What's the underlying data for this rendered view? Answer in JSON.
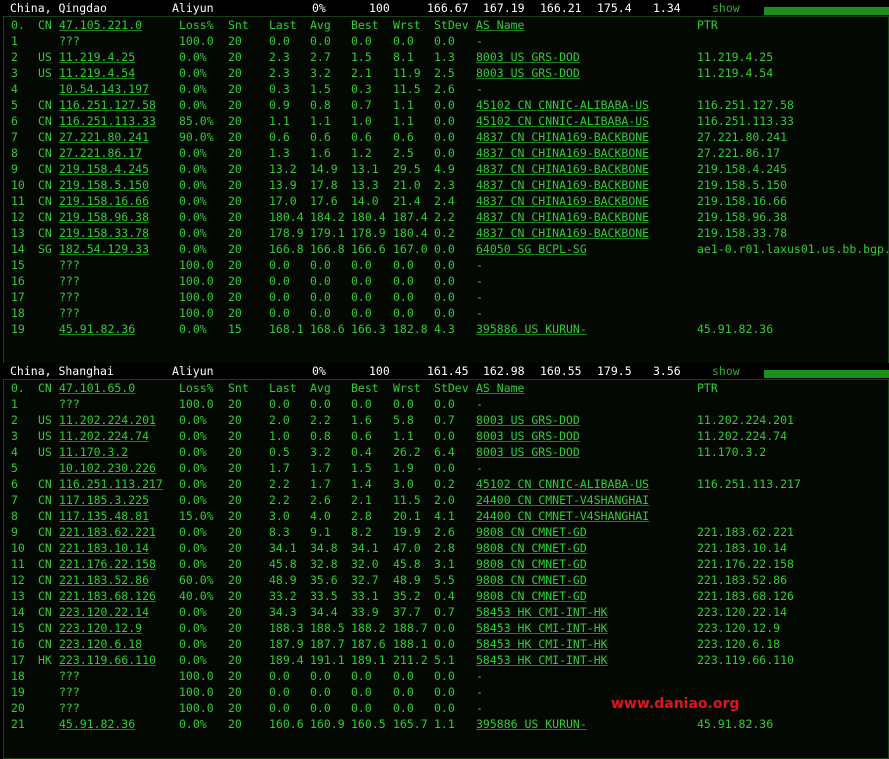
{
  "colors": {
    "text": "#33cc33",
    "header_text": "#ffffff",
    "watermark": "#e0141e",
    "bar": "#1a8f1a"
  },
  "columns": [
    "Loss%",
    "Snt",
    "Last",
    "Avg",
    "Best",
    "Wrst",
    "StDev",
    "AS Name",
    "PTR"
  ],
  "sections": [
    {
      "header": {
        "location": "China, Qingdao",
        "provider": "Aliyun",
        "loss": "0%",
        "sent": "100",
        "last": "166.67",
        "avg": "167.19",
        "best": "166.21",
        "worst": "175.4",
        "stdev": "1.34",
        "show": "show"
      },
      "rows": [
        [
          "0.",
          "CN",
          "47.105.221.0",
          "Loss%",
          "Snt",
          "Last",
          "Avg",
          "Best",
          "Wrst",
          "StDev",
          "AS Name",
          "PTR"
        ],
        [
          "1",
          "",
          "???",
          "100.0",
          "20",
          "0.0",
          "0.0",
          "0.0",
          "0.0",
          "0.0",
          "-",
          ""
        ],
        [
          "2",
          "US",
          "11.219.4.25",
          "0.0%",
          "20",
          "2.3",
          "2.7",
          "1.5",
          "8.1",
          "1.3",
          "8003  US GRS-DOD",
          "11.219.4.25"
        ],
        [
          "3",
          "US",
          "11.219.4.54",
          "0.0%",
          "20",
          "2.3",
          "3.2",
          "2.1",
          "11.9",
          "2.5",
          "8003  US GRS-DOD",
          "11.219.4.54"
        ],
        [
          "4",
          "",
          "10.54.143.197",
          "0.0%",
          "20",
          "0.3",
          "1.5",
          "0.3",
          "11.5",
          "2.6",
          "-",
          ""
        ],
        [
          "5",
          "CN",
          "116.251.127.58",
          "0.0%",
          "20",
          "0.9",
          "0.8",
          "0.7",
          "1.1",
          "0.0",
          "45102 CN CNNIC-ALIBABA-US",
          "116.251.127.58"
        ],
        [
          "6",
          "CN",
          "116.251.113.33",
          "85.0%",
          "20",
          "1.1",
          "1.1",
          "1.0",
          "1.1",
          "0.0",
          "45102 CN CNNIC-ALIBABA-US",
          "116.251.113.33"
        ],
        [
          "7",
          "CN",
          "27.221.80.241",
          "90.0%",
          "20",
          "0.6",
          "0.6",
          "0.6",
          "0.6",
          "0.0",
          "4837  CN CHINA169-BACKBONE",
          "27.221.80.241"
        ],
        [
          "8",
          "CN",
          "27.221.86.17",
          "0.0%",
          "20",
          "1.3",
          "1.6",
          "1.2",
          "2.5",
          "0.0",
          "4837  CN CHINA169-BACKBONE",
          "27.221.86.17"
        ],
        [
          "9",
          "CN",
          "219.158.4.245",
          "0.0%",
          "20",
          "13.2",
          "14.9",
          "13.1",
          "29.5",
          "4.9",
          "4837  CN CHINA169-BACKBONE",
          "219.158.4.245"
        ],
        [
          "10",
          "CN",
          "219.158.5.150",
          "0.0%",
          "20",
          "13.9",
          "17.8",
          "13.3",
          "21.0",
          "2.3",
          "4837  CN CHINA169-BACKBONE",
          "219.158.5.150"
        ],
        [
          "11",
          "CN",
          "219.158.16.66",
          "0.0%",
          "20",
          "17.0",
          "17.6",
          "14.0",
          "21.4",
          "2.4",
          "4837  CN CHINA169-BACKBONE",
          "219.158.16.66"
        ],
        [
          "12",
          "CN",
          "219.158.96.38",
          "0.0%",
          "20",
          "180.4",
          "184.2",
          "180.4",
          "187.4",
          "2.2",
          "4837  CN CHINA169-BACKBONE",
          "219.158.96.38"
        ],
        [
          "13",
          "CN",
          "219.158.33.78",
          "0.0%",
          "20",
          "178.9",
          "179.1",
          "178.9",
          "180.4",
          "0.2",
          "4837  CN CHINA169-BACKBONE",
          "219.158.33.78"
        ],
        [
          "14",
          "SG",
          "182.54.129.33",
          "0.0%",
          "20",
          "166.8",
          "166.8",
          "166.6",
          "167.0",
          "0.0",
          "64050 SG BCPL-SG",
          "ae1-0.r01.laxus01.us.bb.bgp."
        ],
        [
          "15",
          "",
          "???",
          "100.0",
          "20",
          "0.0",
          "0.0",
          "0.0",
          "0.0",
          "0.0",
          "-",
          ""
        ],
        [
          "16",
          "",
          "???",
          "100.0",
          "20",
          "0.0",
          "0.0",
          "0.0",
          "0.0",
          "0.0",
          "-",
          ""
        ],
        [
          "17",
          "",
          "???",
          "100.0",
          "20",
          "0.0",
          "0.0",
          "0.0",
          "0.0",
          "0.0",
          "-",
          ""
        ],
        [
          "18",
          "",
          "???",
          "100.0",
          "20",
          "0.0",
          "0.0",
          "0.0",
          "0.0",
          "0.0",
          "-",
          ""
        ],
        [
          "19",
          "",
          "45.91.82.36",
          "0.0%",
          "15",
          "168.1",
          "168.6",
          "166.3",
          "182.8",
          "4.3",
          "395886 US KURUN-",
          "45.91.82.36"
        ]
      ]
    },
    {
      "header": {
        "location": "China, Shanghai",
        "provider": "Aliyun",
        "loss": "0%",
        "sent": "100",
        "last": "161.45",
        "avg": "162.98",
        "best": "160.55",
        "worst": "179.5",
        "stdev": "3.56",
        "show": "show"
      },
      "rows": [
        [
          "0.",
          "CN",
          "47.101.65.0",
          "Loss%",
          "Snt",
          "Last",
          "Avg",
          "Best",
          "Wrst",
          "StDev",
          "AS Name",
          "PTR"
        ],
        [
          "1",
          "",
          "???",
          "100.0",
          "20",
          "0.0",
          "0.0",
          "0.0",
          "0.0",
          "0.0",
          "-",
          ""
        ],
        [
          "2",
          "US",
          "11.202.224.201",
          "0.0%",
          "20",
          "2.0",
          "2.2",
          "1.6",
          "5.8",
          "0.7",
          "8003  US GRS-DOD",
          "11.202.224.201"
        ],
        [
          "3",
          "US",
          "11.202.224.74",
          "0.0%",
          "20",
          "1.0",
          "0.8",
          "0.6",
          "1.1",
          "0.0",
          "8003  US GRS-DOD",
          "11.202.224.74"
        ],
        [
          "4",
          "US",
          "11.170.3.2",
          "0.0%",
          "20",
          "0.5",
          "3.2",
          "0.4",
          "26.2",
          "6.4",
          "8003  US GRS-DOD",
          "11.170.3.2"
        ],
        [
          "5",
          "",
          "10.102.230.226",
          "0.0%",
          "20",
          "1.7",
          "1.7",
          "1.5",
          "1.9",
          "0.0",
          "-",
          ""
        ],
        [
          "6",
          "CN",
          "116.251.113.217",
          "0.0%",
          "20",
          "2.2",
          "1.7",
          "1.4",
          "3.0",
          "0.2",
          "45102 CN CNNIC-ALIBABA-US",
          "116.251.113.217"
        ],
        [
          "7",
          "CN",
          "117.185.3.225",
          "0.0%",
          "20",
          "2.2",
          "2.6",
          "2.1",
          "11.5",
          "2.0",
          "24400 CN CMNET-V4SHANGHAI",
          ""
        ],
        [
          "8",
          "CN",
          "117.135.48.81",
          "15.0%",
          "20",
          "3.0",
          "4.0",
          "2.8",
          "20.1",
          "4.1",
          "24400 CN CMNET-V4SHANGHAI",
          ""
        ],
        [
          "9",
          "CN",
          "221.183.62.221",
          "0.0%",
          "20",
          "8.3",
          "9.1",
          "8.2",
          "19.9",
          "2.6",
          "9808  CN CMNET-GD",
          "221.183.62.221"
        ],
        [
          "10",
          "CN",
          "221.183.10.14",
          "0.0%",
          "20",
          "34.1",
          "34.8",
          "34.1",
          "47.0",
          "2.8",
          "9808  CN CMNET-GD",
          "221.183.10.14"
        ],
        [
          "11",
          "CN",
          "221.176.22.158",
          "0.0%",
          "20",
          "45.8",
          "32.8",
          "32.0",
          "45.8",
          "3.1",
          "9808  CN CMNET-GD",
          "221.176.22.158"
        ],
        [
          "12",
          "CN",
          "221.183.52.86",
          "60.0%",
          "20",
          "48.9",
          "35.6",
          "32.7",
          "48.9",
          "5.5",
          "9808  CN CMNET-GD",
          "221.183.52.86"
        ],
        [
          "13",
          "CN",
          "221.183.68.126",
          "40.0%",
          "20",
          "33.2",
          "33.5",
          "33.1",
          "35.2",
          "0.4",
          "9808  CN CMNET-GD",
          "221.183.68.126"
        ],
        [
          "14",
          "CN",
          "223.120.22.14",
          "0.0%",
          "20",
          "34.3",
          "34.4",
          "33.9",
          "37.7",
          "0.7",
          "58453 HK CMI-INT-HK",
          "223.120.22.14"
        ],
        [
          "15",
          "CN",
          "223.120.12.9",
          "0.0%",
          "20",
          "188.3",
          "188.5",
          "188.2",
          "188.7",
          "0.0",
          "58453 HK CMI-INT-HK",
          "223.120.12.9"
        ],
        [
          "16",
          "CN",
          "223.120.6.18",
          "0.0%",
          "20",
          "187.9",
          "187.7",
          "187.6",
          "188.1",
          "0.0",
          "58453 HK CMI-INT-HK",
          "223.120.6.18"
        ],
        [
          "17",
          "HK",
          "223.119.66.110",
          "0.0%",
          "20",
          "189.4",
          "191.1",
          "189.1",
          "211.2",
          "5.1",
          "58453 HK CMI-INT-HK",
          "223.119.66.110"
        ],
        [
          "18",
          "",
          "???",
          "100.0",
          "20",
          "0.0",
          "0.0",
          "0.0",
          "0.0",
          "0.0",
          "-",
          ""
        ],
        [
          "19",
          "",
          "???",
          "100.0",
          "20",
          "0.0",
          "0.0",
          "0.0",
          "0.0",
          "0.0",
          "-",
          ""
        ],
        [
          "20",
          "",
          "???",
          "100.0",
          "20",
          "0.0",
          "0.0",
          "0.0",
          "0.0",
          "0.0",
          "-",
          ""
        ],
        [
          "21",
          "",
          "45.91.82.36",
          "0.0%",
          "20",
          "160.6",
          "160.9",
          "160.5",
          "165.7",
          "1.1",
          "395886 US KURUN-",
          "45.91.82.36"
        ]
      ]
    }
  ],
  "watermark": "www.daniao.org"
}
